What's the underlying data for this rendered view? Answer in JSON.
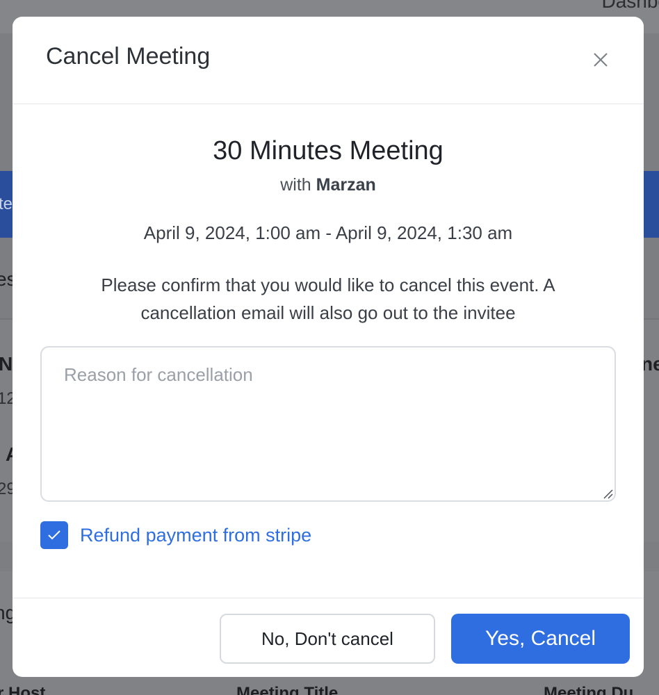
{
  "background": {
    "top_right_fragment": "Dashbo",
    "band_fragment": "te",
    "section_fragment": "es",
    "left_fragments": [
      "N",
      "12",
      "A",
      "29"
    ],
    "right_fragment": "ne",
    "lower_fragment": "ng",
    "bottom_columns": [
      "r Host",
      "Meeting Title",
      "Meeting Du"
    ]
  },
  "modal": {
    "title": "Cancel Meeting",
    "close_icon": "close-icon",
    "event": {
      "title": "30 Minutes Meeting",
      "with_prefix": "with",
      "host": "Marzan",
      "time_range": "April 9, 2024, 1:00 am - April 9, 2024, 1:30 am"
    },
    "confirm_message": "Please confirm that you would like to cancel this event. A cancellation email will also go out to the invitee",
    "reason": {
      "value": "",
      "placeholder": "Reason for cancellation"
    },
    "refund": {
      "checked": true,
      "label": "Refund payment from stripe"
    },
    "buttons": {
      "secondary_label": "No, Don't cancel",
      "primary_label": "Yes, Cancel"
    }
  },
  "colors": {
    "accent": "#2f6ee0",
    "text_primary": "#1f2329",
    "overlay": "#7d7e82"
  }
}
